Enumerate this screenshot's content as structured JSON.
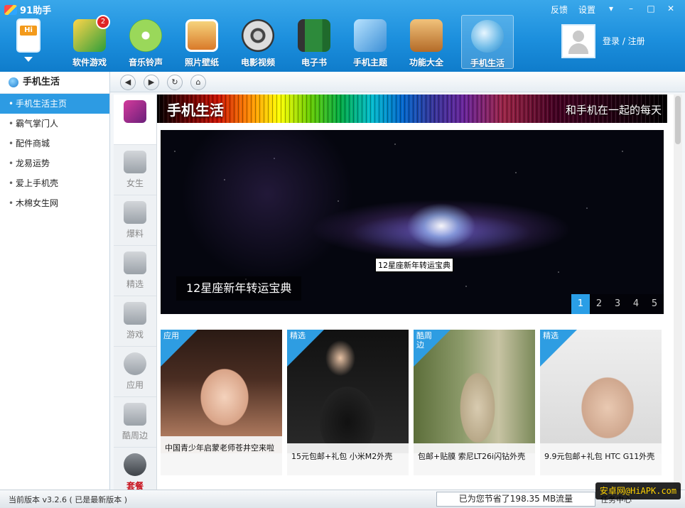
{
  "app": {
    "title": "91助手",
    "header_links": [
      "反馈",
      "设置"
    ],
    "window_buttons": [
      "▾",
      "–",
      "□",
      "✕"
    ]
  },
  "nav": [
    {
      "label": "软件游戏",
      "icon": "joystick-icon",
      "badge": "2"
    },
    {
      "label": "音乐铃声",
      "icon": "music-cd-icon"
    },
    {
      "label": "照片壁纸",
      "icon": "photo-icon"
    },
    {
      "label": "电影视频",
      "icon": "film-reel-icon"
    },
    {
      "label": "电子书",
      "icon": "book-icon"
    },
    {
      "label": "手机主题",
      "icon": "palette-icon"
    },
    {
      "label": "功能大全",
      "icon": "toolbox-icon"
    },
    {
      "label": "手机生活",
      "icon": "life-globe-icon",
      "active": true
    }
  ],
  "user": {
    "login_label": "登录 / 注册"
  },
  "sidebar": {
    "title": "手机生活",
    "items": [
      {
        "label": "手机生活主页",
        "active": true
      },
      {
        "label": "霸气掌门人"
      },
      {
        "label": "配件商城"
      },
      {
        "label": "龙易运势"
      },
      {
        "label": "爱上手机壳"
      },
      {
        "label": "木棉女生网"
      }
    ]
  },
  "toolbar": {
    "buttons": [
      "back",
      "forward",
      "refresh",
      "home"
    ]
  },
  "categories": [
    {
      "label": "",
      "icon": "phone-icon",
      "active": true
    },
    {
      "label": "女生",
      "icon": "high-heel-icon"
    },
    {
      "label": "爆料",
      "icon": "microphone-icon"
    },
    {
      "label": "精选",
      "icon": "price-tag-icon"
    },
    {
      "label": "游戏",
      "icon": "gamepad-icon"
    },
    {
      "label": "应用",
      "icon": "app-store-icon"
    },
    {
      "label": "酷周边",
      "icon": "gift-icon"
    },
    {
      "label": "套餐",
      "icon": "home-icon",
      "highlight": true
    }
  ],
  "content": {
    "header_title": "手机生活",
    "header_slogan": "和手机在一起的每天",
    "banner": {
      "tooltip": "12星座新年转运宝典",
      "caption": "12星座新年转运宝典",
      "pages": [
        "1",
        "2",
        "3",
        "4",
        "5"
      ],
      "active_page": "1"
    },
    "cards": [
      {
        "tag": "应用",
        "caption": "中国青少年启蒙老师苍井空来啦"
      },
      {
        "tag": "精选",
        "caption": "15元包邮+礼包 小米M2外壳"
      },
      {
        "tag": "酷周边",
        "caption": "包邮+贴膜 索尼LT26i闪钻外壳"
      },
      {
        "tag": "精选",
        "caption": "9.9元包邮+礼包 HTC G11外壳"
      }
    ]
  },
  "status": {
    "version_label": "当前版本",
    "version": "v3.2.6",
    "version_note": "( 已是最新版本 )",
    "saved_text": "已为您节省了198.35 MB流量",
    "task_center": "任务中心",
    "watermark": "安卓网@HiAPK.com"
  }
}
